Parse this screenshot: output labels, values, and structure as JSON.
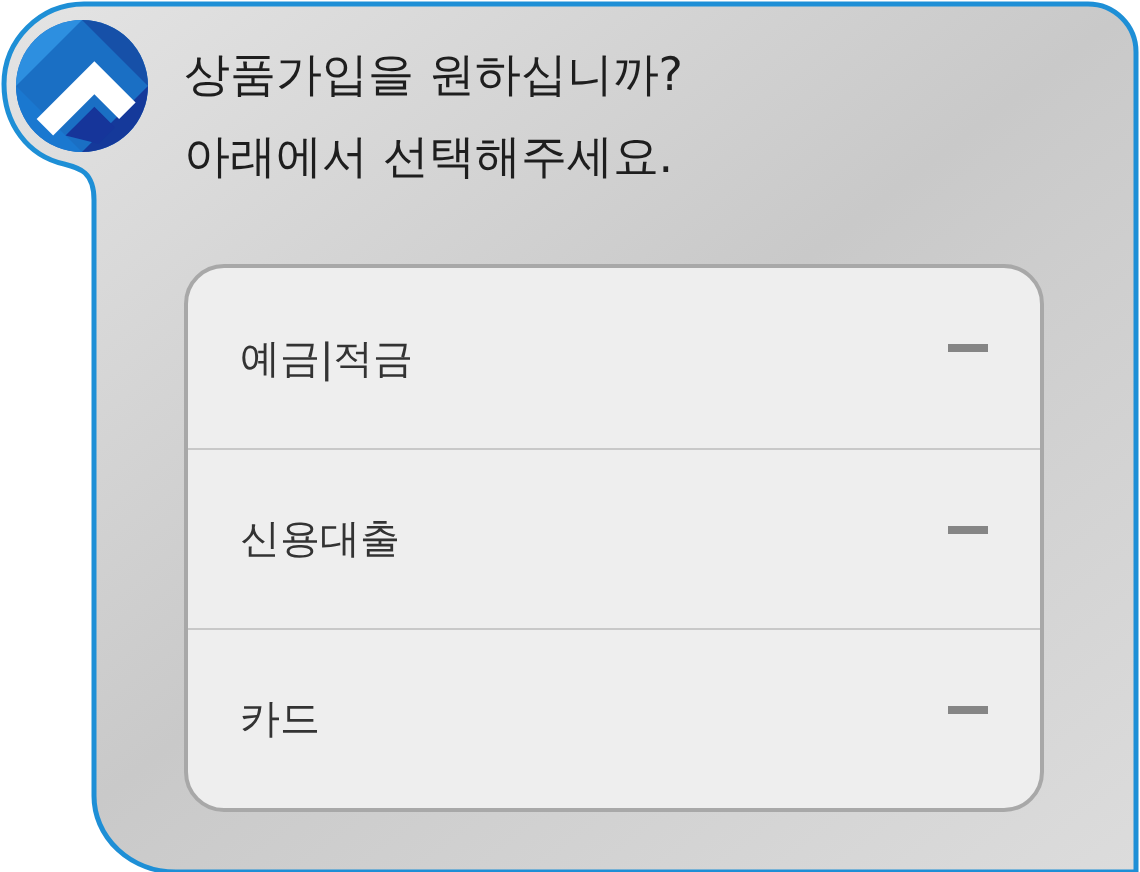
{
  "message": {
    "lines": [
      "상품가입을 원하십니까?",
      "아래에서 선택해주세요."
    ]
  },
  "options": [
    {
      "label": "예금|적금"
    },
    {
      "label": "신용대출"
    },
    {
      "label": "카드"
    }
  ]
}
